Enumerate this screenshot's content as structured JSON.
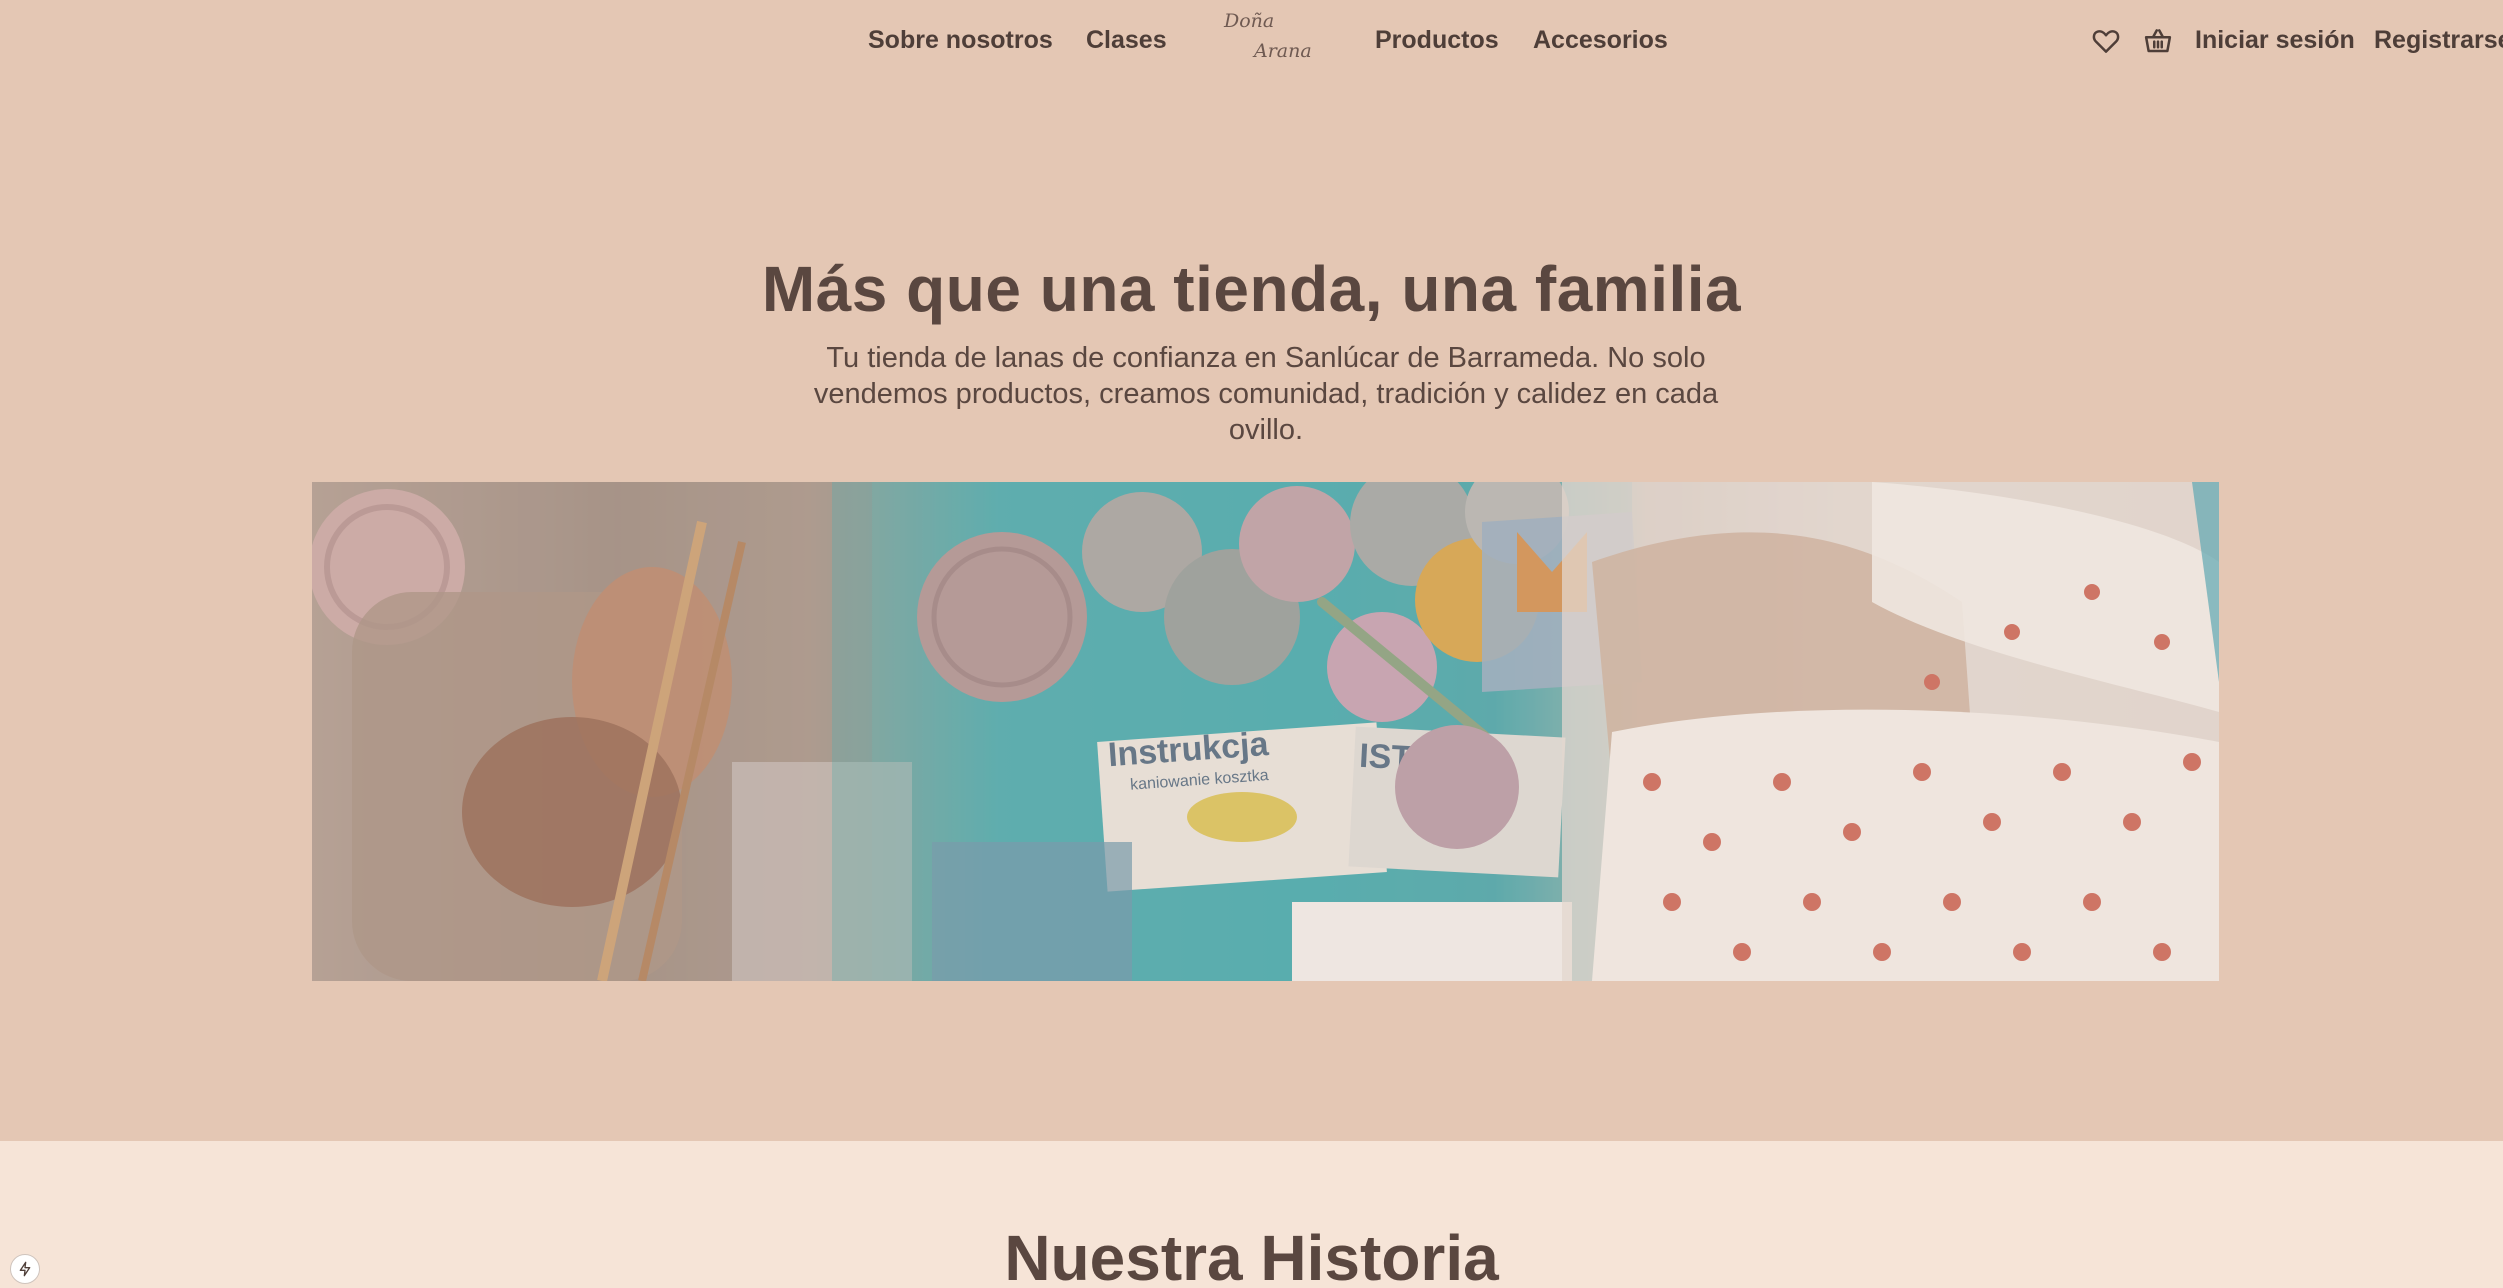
{
  "nav": {
    "links_left": [
      "Sobre nosotros",
      "Clases"
    ],
    "links_right": [
      "Productos",
      "Accesorios"
    ],
    "logo": {
      "line1": "Doña",
      "line2": "Arana"
    },
    "icons": [
      "heart-icon",
      "basket-icon"
    ],
    "login": "Iniciar sesión",
    "register": "Registrarse"
  },
  "hero": {
    "title": "Más que una tienda, una familia",
    "subtitle": "Tu tienda de lanas de confianza en Sanlúcar de Barrameda. No solo vendemos productos, creamos comunidad, tradición y calidez en cada ovillo.",
    "image_text": [
      "Instrukcja",
      "kaniowanie kosztka",
      "IST"
    ]
  },
  "story": {
    "title": "Nuestra Historia"
  },
  "colors": {
    "page_bg": "#e4c7b4",
    "section_bg": "#f6e4d7",
    "text": "#5a4740"
  }
}
